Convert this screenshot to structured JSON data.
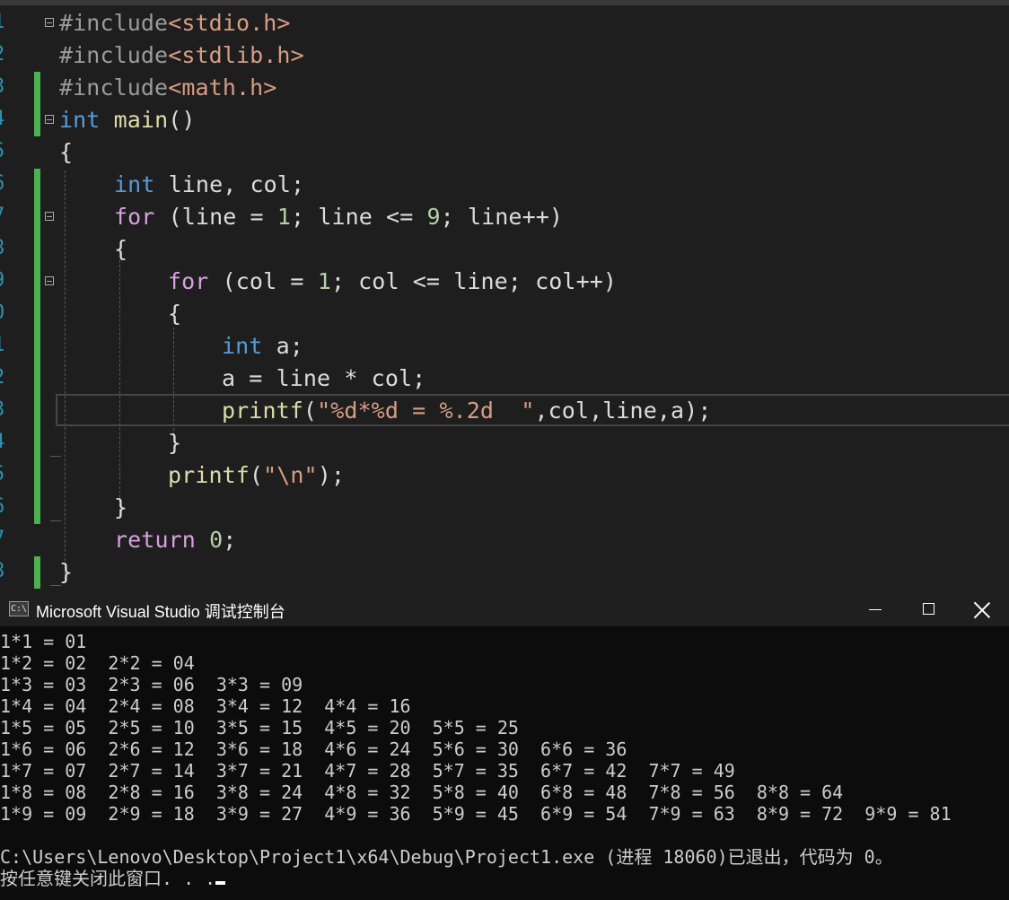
{
  "editor": {
    "lines": [
      {
        "num": "1",
        "text": "#include<stdio.h>"
      },
      {
        "num": "2",
        "text": "#include<stdlib.h>"
      },
      {
        "num": "3",
        "text": "#include<math.h>"
      },
      {
        "num": "4",
        "text": "int main()"
      },
      {
        "num": "5",
        "text": "{"
      },
      {
        "num": "6",
        "text": "int line, col;"
      },
      {
        "num": "7",
        "text": "for (line = 1; line <= 9; line++)"
      },
      {
        "num": "8",
        "text": "{"
      },
      {
        "num": "9",
        "text": "for (col = 1; col <= line; col++)"
      },
      {
        "num": "0",
        "text": "{"
      },
      {
        "num": "1",
        "text": "int a;"
      },
      {
        "num": "2",
        "text": "a = line * col;"
      },
      {
        "num": "3",
        "text": "printf(\"%d*%d = %.2d  \",col,line,a);"
      },
      {
        "num": "4",
        "text": "}"
      },
      {
        "num": "5",
        "text": "printf(\"\\n\");"
      },
      {
        "num": "6",
        "text": "}"
      },
      {
        "num": "7",
        "text": "return 0;"
      },
      {
        "num": "8",
        "text": "}"
      }
    ]
  },
  "console": {
    "title": "Microsoft Visual Studio 调试控制台",
    "icon_label": "C:\\",
    "output_lines": [
      "1*1 = 01",
      "1*2 = 02  2*2 = 04",
      "1*3 = 03  2*3 = 06  3*3 = 09",
      "1*4 = 04  2*4 = 08  3*4 = 12  4*4 = 16",
      "1*5 = 05  2*5 = 10  3*5 = 15  4*5 = 20  5*5 = 25",
      "1*6 = 06  2*6 = 12  3*6 = 18  4*6 = 24  5*6 = 30  6*6 = 36",
      "1*7 = 07  2*7 = 14  3*7 = 21  4*7 = 28  5*7 = 35  6*7 = 42  7*7 = 49",
      "1*8 = 08  2*8 = 16  3*8 = 24  4*8 = 32  5*8 = 40  6*8 = 48  7*8 = 56  8*8 = 64",
      "1*9 = 09  2*9 = 18  3*9 = 27  4*9 = 36  5*9 = 45  6*9 = 54  7*9 = 63  8*9 = 72  9*9 = 81"
    ],
    "exit_message": "C:\\Users\\Lenovo\\Desktop\\Project1\\x64\\Debug\\Project1.exe (进程 18060)已退出，代码为 0。",
    "press_key_message": "按任意键关闭此窗口. . .",
    "icons": {
      "minimize": "minimize-icon",
      "maximize": "maximize-icon",
      "close": "close-icon"
    }
  },
  "colors": {
    "editor_bg": "#1e1e1e",
    "console_bg": "#0c0c0c",
    "keyword": "#569cd6",
    "control_keyword": "#d8a0df",
    "function": "#dcdcaa",
    "string": "#d69d85",
    "number": "#b5cea8",
    "line_number": "#2b91af",
    "change_marker": "#4caf50"
  }
}
